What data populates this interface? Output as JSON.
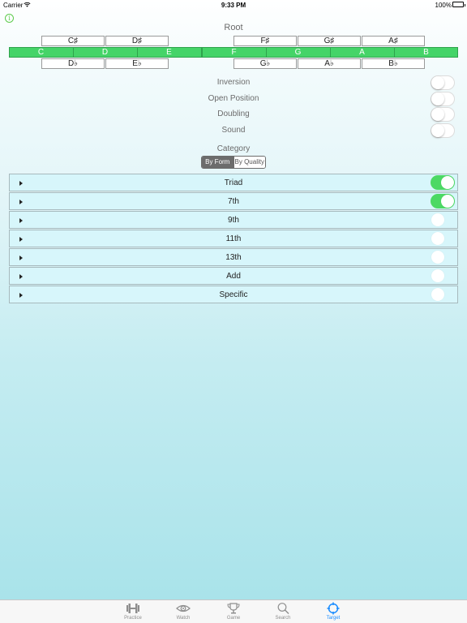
{
  "status_bar": {
    "carrier": "Carrier",
    "time": "9:33 PM",
    "battery": "100%"
  },
  "root_label": "Root",
  "sharps": [
    {
      "label": "C♯"
    },
    {
      "label": "D♯"
    },
    {
      "label": "F♯"
    },
    {
      "label": "G♯"
    },
    {
      "label": "A♯"
    }
  ],
  "naturals": [
    {
      "label": "C"
    },
    {
      "label": "D"
    },
    {
      "label": "E"
    },
    {
      "label": "F"
    },
    {
      "label": "G"
    },
    {
      "label": "A"
    },
    {
      "label": "B"
    }
  ],
  "flats": [
    {
      "label": "D♭"
    },
    {
      "label": "E♭"
    },
    {
      "label": "G♭"
    },
    {
      "label": "A♭"
    },
    {
      "label": "B♭"
    }
  ],
  "options": [
    {
      "label": "Inversion",
      "on": false
    },
    {
      "label": "Open Position",
      "on": false
    },
    {
      "label": "Doubling",
      "on": false
    },
    {
      "label": "Sound",
      "on": false
    }
  ],
  "category_label": "Category",
  "category_segments": [
    {
      "label": "By Form",
      "selected": true
    },
    {
      "label": "By Quality",
      "selected": false
    }
  ],
  "categories": [
    {
      "label": "Triad",
      "on": true
    },
    {
      "label": "7th",
      "on": true
    },
    {
      "label": "9th",
      "on": false
    },
    {
      "label": "11th",
      "on": false
    },
    {
      "label": "13th",
      "on": false
    },
    {
      "label": "Add",
      "on": false
    },
    {
      "label": "Specific",
      "on": false
    }
  ],
  "tabs": [
    {
      "label": "Practice",
      "icon": "dumbbell-icon",
      "active": false
    },
    {
      "label": "Watch",
      "icon": "eye-icon",
      "active": false
    },
    {
      "label": "Game",
      "icon": "trophy-icon",
      "active": false
    },
    {
      "label": "Search",
      "icon": "magnifier-icon",
      "active": false
    },
    {
      "label": "Target",
      "icon": "crosshair-icon",
      "active": true
    }
  ],
  "colors": {
    "accent_green": "#4cd964",
    "key_green": "#45d468",
    "tab_active": "#1a8cff"
  }
}
